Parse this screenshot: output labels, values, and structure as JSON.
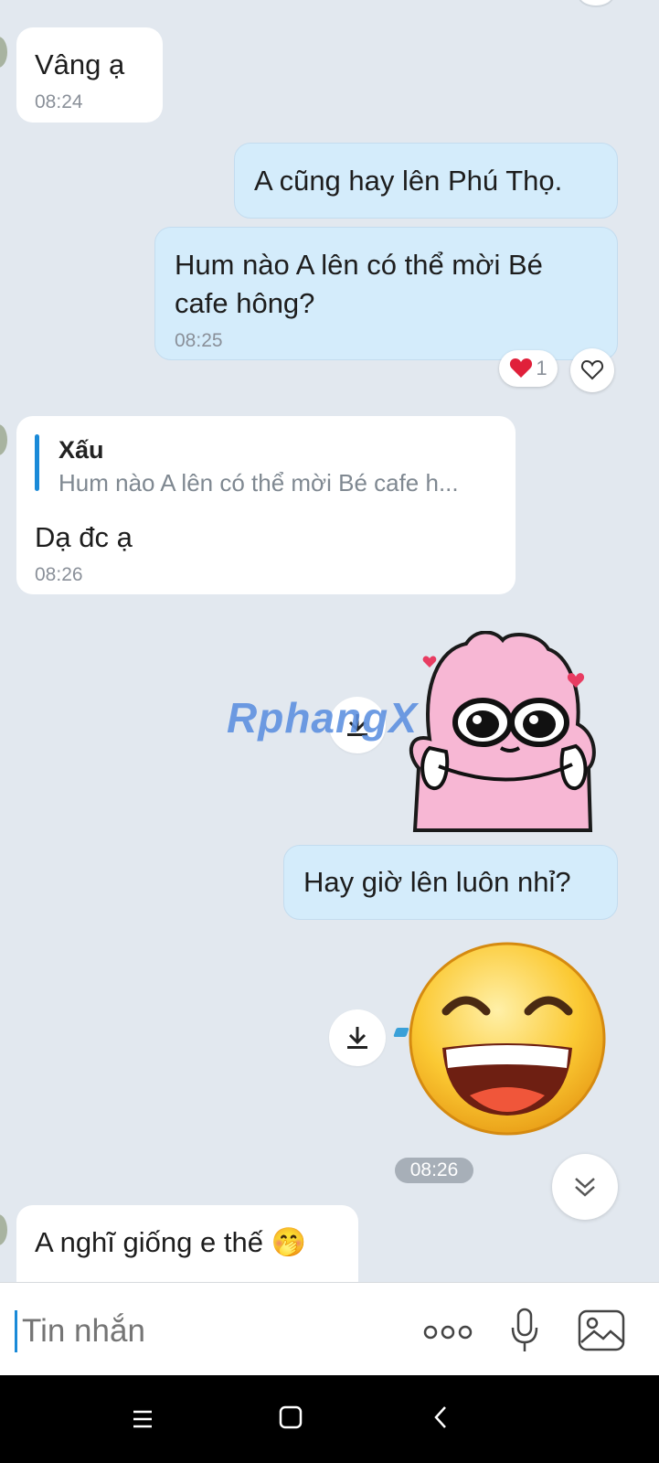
{
  "messages": {
    "m1": {
      "text": "Vâng ạ",
      "time": "08:24"
    },
    "m2": {
      "text": "A cũng hay lên Phú Thọ."
    },
    "m3": {
      "line1": "Hum nào A lên có thể mời Bé",
      "line2": "cafe hông?",
      "time": "08:25",
      "reaction_count": "1"
    },
    "m4": {
      "quote_author": "Xấu",
      "quote_text": "Hum nào A lên có thể mời Bé cafe h...",
      "text": "Dạ đc ạ",
      "time": "08:26"
    },
    "m5": {
      "text": "Hay giờ lên luôn nhỉ?"
    },
    "time_chip": "08:26",
    "m6": {
      "text": "A nghĩ giống e thế 🤭"
    }
  },
  "watermark": "RphangX",
  "input": {
    "placeholder": "Tin nhắn"
  },
  "icons": {
    "heart": "heart-icon",
    "react": "heart-outline-icon",
    "download": "download-icon",
    "scroll_down": "double-chevron-down-icon",
    "more": "more-dots-icon",
    "mic": "microphone-icon",
    "image": "image-icon",
    "nav_menu": "menu-icon",
    "nav_home": "home-square-icon",
    "nav_back": "back-chevron-icon"
  },
  "colors": {
    "outgoing_bubble": "#d4ecfb",
    "incoming_bubble": "#ffffff",
    "quote_bar": "#1a8ad8",
    "background": "#e2e8ef",
    "sticker_pink": "#f7b7d4"
  }
}
